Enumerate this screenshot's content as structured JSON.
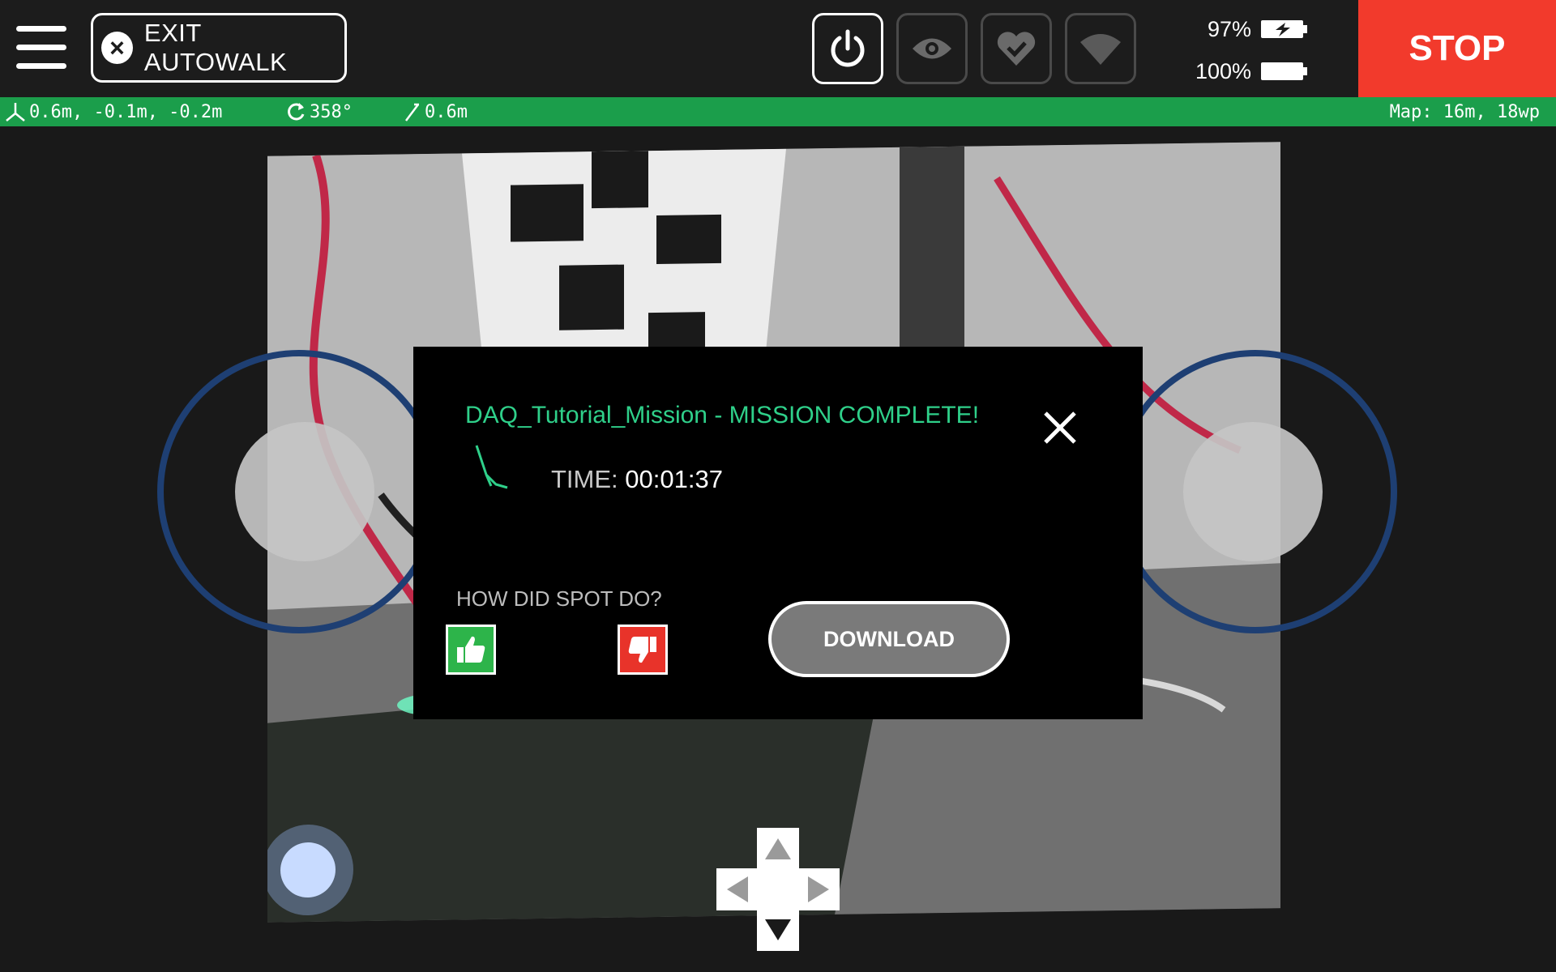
{
  "topbar": {
    "exit_label": "EXIT AUTOWALK",
    "icons": [
      "power-icon",
      "eye-icon",
      "heart-check-icon",
      "wifi-icon"
    ],
    "battery": [
      {
        "value": "97%",
        "charging": true
      },
      {
        "value": "100%",
        "charging": false
      }
    ],
    "stop_label": "STOP"
  },
  "status": {
    "position": "0.6m, -0.1m, -0.2m",
    "rotation": "358°",
    "distance": "0.6m",
    "map": "Map: 16m, 18wp"
  },
  "dialog": {
    "title": "DAQ_Tutorial_Mission - MISSION COMPLETE!",
    "time_label": "TIME:",
    "time_value": "00:01:37",
    "feedback_prompt": "HOW DID SPOT DO?",
    "download_label": "DOWNLOAD"
  },
  "colors": {
    "stop": "#f23a2c",
    "status_bar": "#1b9e4b",
    "title_green": "#2fd08a",
    "thumb_up": "#2db44a",
    "thumb_down": "#e8332a",
    "joystick_ring": "#1e3f73"
  }
}
